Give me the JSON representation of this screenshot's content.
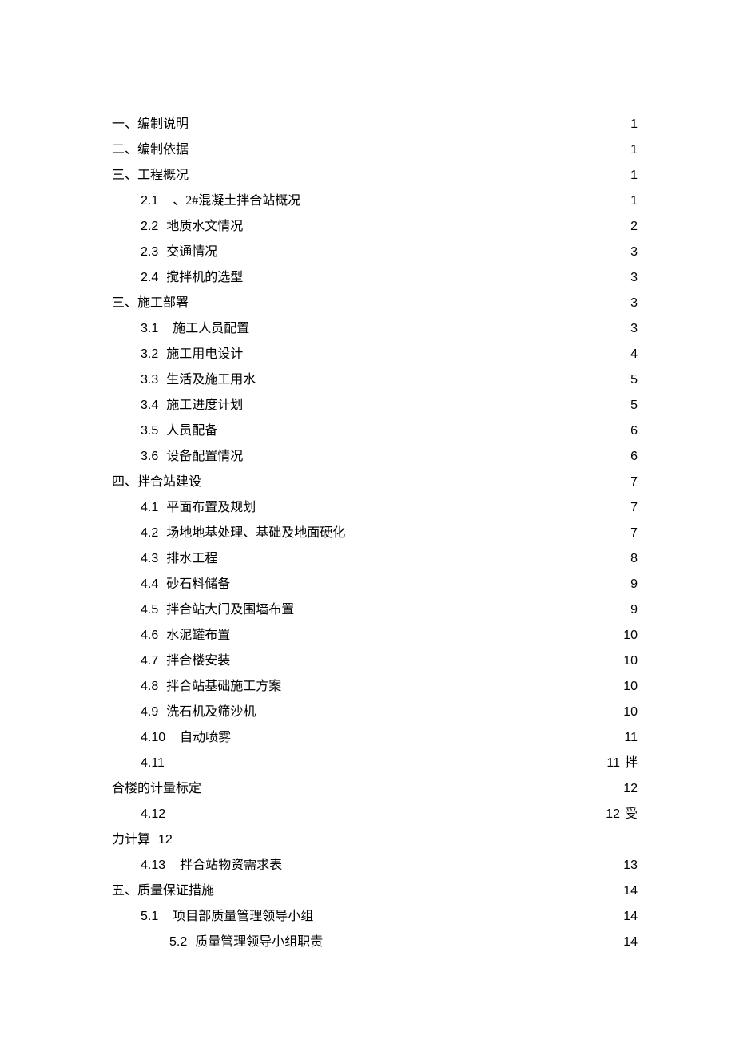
{
  "toc": {
    "s1": {
      "label": "一、编制说明",
      "page": "1"
    },
    "s2": {
      "label": "二、编制依据",
      "page": "1"
    },
    "s3": {
      "label": "三、工程概况",
      "page": "1"
    },
    "s3_2_1": {
      "num": "2.1",
      "label": "、2#混凝土拌合站概况",
      "page": "1"
    },
    "s3_2_2": {
      "num": "2.2",
      "label": "地质水文情况",
      "page": "2"
    },
    "s3_2_3": {
      "num": "2.3",
      "label": "交通情况",
      "page": "3"
    },
    "s3_2_4": {
      "num": "2.4",
      "label": "搅拌机的选型",
      "page": "3"
    },
    "s3b": {
      "label": "三、施工部署",
      "page": "3"
    },
    "s3b_3_1": {
      "num": "3.1",
      "label": "施工人员配置",
      "page": "3"
    },
    "s3b_3_2": {
      "num": "3.2",
      "label": "施工用电设计",
      "page": "4"
    },
    "s3b_3_3": {
      "num": "3.3",
      "label": "生活及施工用水",
      "page": "5"
    },
    "s3b_3_4": {
      "num": "3.4",
      "label": "施工进度计划",
      "page": "5"
    },
    "s3b_3_5": {
      "num": "3.5",
      "label": "人员配备",
      "page": "6"
    },
    "s3b_3_6": {
      "num": "3.6",
      "label": "设备配置情况",
      "page": "6"
    },
    "s4": {
      "label": "四、拌合站建设",
      "page": "7"
    },
    "s4_4_1": {
      "num": "4.1",
      "label": "平面布置及规划",
      "page": "7"
    },
    "s4_4_2": {
      "num": "4.2",
      "label": "场地地基处理、基础及地面硬化",
      "page": "7"
    },
    "s4_4_3": {
      "num": "4.3",
      "label": "排水工程",
      "page": "8"
    },
    "s4_4_4": {
      "num": "4.4",
      "label": "砂石料储备",
      "page": "9"
    },
    "s4_4_5": {
      "num": "4.5",
      "label": "拌合站大门及围墙布置",
      "page": "9"
    },
    "s4_4_6": {
      "num": "4.6",
      "label": "水泥罐布置",
      "page": "10"
    },
    "s4_4_7": {
      "num": "4.7",
      "label": "拌合楼安装",
      "page": "10"
    },
    "s4_4_8": {
      "num": "4.8",
      "label": "拌合站基础施工方案",
      "page": "10"
    },
    "s4_4_9": {
      "num": "4.9",
      "label": "洗石机及筛沙机",
      "page": "10"
    },
    "s4_4_10": {
      "num": "4.10",
      "label": "自动喷雾",
      "page": "11"
    },
    "s4_4_11": {
      "num": "4.11",
      "page1": "11",
      "trail": "拌",
      "cont_label": "合楼的计量标定",
      "page2": "12"
    },
    "s4_4_12": {
      "num": "4.12",
      "page1": "12",
      "trail": "受",
      "cont_label": "力计算",
      "page2": "12"
    },
    "s4_4_13": {
      "num": "4.13",
      "label": "拌合站物资需求表",
      "page": "13"
    },
    "s5": {
      "label": "五、质量保证措施",
      "page": "14"
    },
    "s5_5_1": {
      "num": "5.1",
      "label": "项目部质量管理领导小组",
      "page": "14"
    },
    "s5_5_2": {
      "num": "5.2",
      "label": "质量管理领导小组职责",
      "page": "14"
    }
  }
}
